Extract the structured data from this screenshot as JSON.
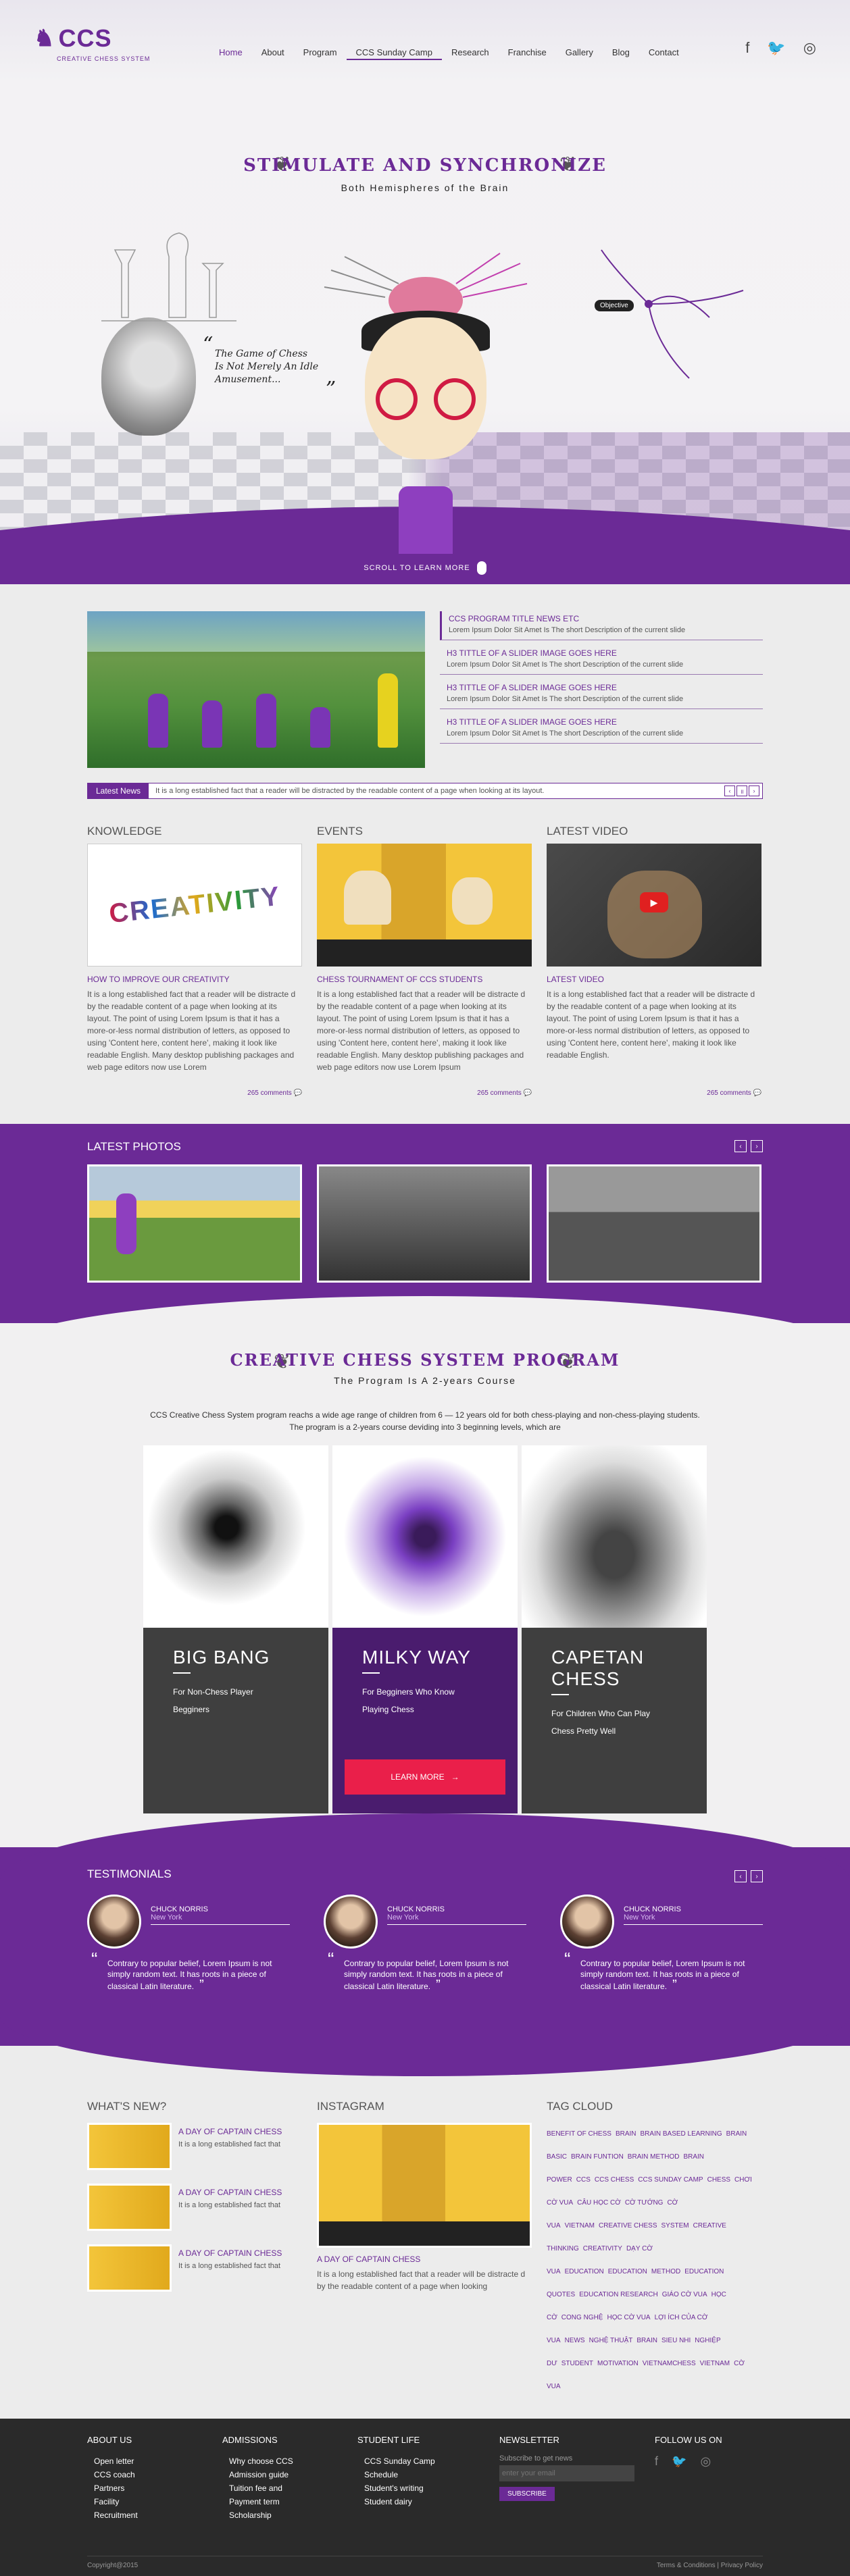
{
  "brand": {
    "logo_text": "CCS",
    "logo_sub": "CREATIVE CHESS SYSTEM",
    "accent": "#6b2a96",
    "red": "#ea1f4a"
  },
  "nav": [
    {
      "label": "Home"
    },
    {
      "label": "About"
    },
    {
      "label": "Program"
    },
    {
      "label": "CCS Sunday Camp"
    },
    {
      "label": "Research"
    },
    {
      "label": "Franchise"
    },
    {
      "label": "Gallery"
    },
    {
      "label": "Blog"
    },
    {
      "label": "Contact"
    }
  ],
  "social": [
    "facebook-icon",
    "twitter-icon",
    "instagram-icon"
  ],
  "hero": {
    "title": "STIMULATE AND SYNCHRONIZE",
    "subtitle": "Both Hemispheres of the Brain",
    "quote_l1": "The Game of Chess",
    "quote_l2": "Is Not Merely An Idle",
    "quote_l3": "Amusement...",
    "objective": "Objective",
    "scroll": "SCROLL TO LEARN MORE"
  },
  "slider": {
    "items": [
      {
        "h": "CCS PROGRAM TITLE NEWS ETC",
        "d": "Lorem Ipsum Dolor Sit Amet Is The short Description of the current slide"
      },
      {
        "h": "H3 TITTLE OF A SLIDER IMAGE GOES HERE",
        "d": "Lorem Ipsum Dolor Sit Amet Is The short Description of the current slide"
      },
      {
        "h": "H3 TITTLE OF A SLIDER IMAGE GOES HERE",
        "d": "Lorem Ipsum Dolor Sit Amet Is The short Description of the current slide"
      },
      {
        "h": "H3 TITTLE OF A SLIDER IMAGE GOES HERE",
        "d": "Lorem Ipsum Dolor Sit Amet Is The short Description of the current slide"
      }
    ],
    "news_label": "Latest News",
    "news_text": "It is a long established fact that a reader will be distracted by the readable content of a page when looking at its layout."
  },
  "cols": [
    {
      "section": "KNOWLEDGE",
      "title": "HOW TO IMPROVE OUR CREATIVITY",
      "img_text": "CREATIVITY",
      "body": "It is a long established fact that a reader will be distracte d by the readable content of a page when looking at its layout. The point of using Lorem Ipsum is that it has a more-or-less normal distribution of letters, as opposed to using 'Content here, content here', making it look like readable English. Many desktop publishing packages and web page editors now use Lorem",
      "comments": "265 comments"
    },
    {
      "section": "EVENTS",
      "title": "CHESS TOURNAMENT OF CCS STUDENTS",
      "body": "It is a long established fact that a reader will be distracte d by the readable content of a page when looking at its layout. The point of using Lorem Ipsum is that it has a more-or-less normal distribution of letters, as opposed to using 'Content here, content here', making it look like readable English. Many desktop publishing packages and web page editors now use Lorem Ipsum",
      "comments": "265 comments"
    },
    {
      "section": "LATEST VIDEO",
      "title": "LATEST VIDEO",
      "body": "It is a long established fact that a reader will be distracte d by the readable content of a page when looking at its layout. The point of using Lorem Ipsum is that it has a more-or-less normal distribution of letters, as opposed to using 'Content here, content here', making it look like readable English.",
      "comments": "265 comments"
    }
  ],
  "photos": {
    "title": "LATEST PHOTOS"
  },
  "program": {
    "title": "CREATIVE CHESS SYSTEM PROGRAM",
    "subtitle": "The Program Is A 2-years Course",
    "intro1": "CCS Creative Chess System program reachs a wide age range of children from 6 — 12 years old for both chess-playing and non-chess-playing students.",
    "intro2": "The program is a 2-years course deviding into 3 beginning levels, which are",
    "cards": [
      {
        "name": "BIG BANG",
        "l1": "For Non-Chess Player",
        "l2": "Begginers"
      },
      {
        "name": "MILKY WAY",
        "l1": "For Begginers Who Know",
        "l2": "Playing Chess",
        "cta": "LEARN MORE"
      },
      {
        "name": "CAPETAN CHESS",
        "l1": "For Children Who Can Play",
        "l2": "Chess Pretty Well"
      }
    ]
  },
  "testimonials": {
    "title": "TESTIMONIALS",
    "items": [
      {
        "name": "CHUCK NORRIS",
        "city": "New York",
        "text": "Contrary to popular belief, Lorem Ipsum is not simply random text. It has roots in a piece of classical Latin literature."
      },
      {
        "name": "CHUCK NORRIS",
        "city": "New York",
        "text": "Contrary to popular belief, Lorem Ipsum is not simply random text. It has roots in a piece of classical Latin literature."
      },
      {
        "name": "CHUCK NORRIS",
        "city": "New York",
        "text": "Contrary to popular belief, Lorem Ipsum is not simply random text. It has roots in a piece of classical Latin literature."
      }
    ]
  },
  "whatsnew": {
    "title": "WHAT'S NEW?",
    "items": [
      {
        "h": "A DAY OF CAPTAIN CHESS",
        "d": "It is a long established fact that"
      },
      {
        "h": "A DAY OF CAPTAIN CHESS",
        "d": "It is a long established fact that"
      },
      {
        "h": "A DAY OF CAPTAIN CHESS",
        "d": "It is a long established fact that"
      }
    ]
  },
  "instagram": {
    "title": "INSTAGRAM",
    "h": "A DAY OF CAPTAIN CHESS",
    "d": "It is a long established fact that a reader will be distracte d by the readable content of a page when looking"
  },
  "tagcloud": {
    "title": "TAG CLOUD",
    "tags": [
      "BENEFIT OF CHESS",
      "BRAIN",
      "BRAIN BASED LEARNING",
      "BRAIN BASIC",
      "BRAIN FUNTION",
      "BRAIN METHOD",
      "BRAIN POWER",
      "CCS",
      "CCS CHESS",
      "CCS SUNDAY CAMP",
      "CHESS",
      "CHƠI CỜ VUA",
      "CÂU HỌC CỜ",
      "CỜ TƯỚNG",
      "CỜ VUA",
      "VIETNAM",
      "CREATIVE CHESS",
      "SYSTEM",
      "CREATIVE THINKING",
      "CREATIVITY",
      "DẠY CỜ VUA",
      "EDUCATION",
      "EDUCATION",
      "METHOD",
      "EDUCATION QUOTES",
      "EDUCATION RESEARCH",
      "GIÁO CỜ VUA",
      "HỌC CỜ",
      "CONG NGHỆ",
      "HỌC CỜ VUA",
      "LỢI ÍCH CỦA CỜ VUA",
      "NEWS",
      "NGHỆ THUẬT",
      "BRAIN",
      "SIEU NHI",
      "NGHIỆP DƯ",
      "STUDENT",
      "MOTIVATION",
      "VIETNAMCHESS",
      "VIETNAM",
      "CỜ VUA"
    ]
  },
  "footer": {
    "about": {
      "h": "ABOUT US",
      "items": [
        "Open letter",
        "CCS coach",
        "Partners",
        "Facility",
        "Recruitment"
      ]
    },
    "admissions": {
      "h": "ADMISSIONS",
      "items": [
        "Why choose CCS",
        "Admission guide",
        "Tuition fee and",
        "Payment term",
        "Scholarship"
      ]
    },
    "student": {
      "h": "STUDENT LIFE",
      "items": [
        "CCS Sunday Camp",
        "Schedule",
        "Student's writing",
        "Student dairy"
      ]
    },
    "newsletter": {
      "h": "NEWSLETTER",
      "sub": "Subscribe to get news",
      "placeholder": "enter your email",
      "btn": "SUBSCRIBE"
    },
    "follow": {
      "h": "FOLLOW US ON"
    },
    "copyright": "Copyright@2015",
    "terms": "Terms & Conditions | Privacy Policy"
  }
}
